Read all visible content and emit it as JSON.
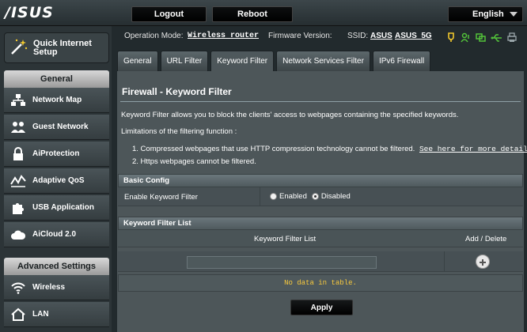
{
  "brand": {
    "logo_text": "/ISUS"
  },
  "topbar": {
    "logout_label": "Logout",
    "reboot_label": "Reboot",
    "language_value": "English"
  },
  "sidebar": {
    "quick_setup": "Quick Internet\nSetup",
    "general_header": "General",
    "general_items": [
      {
        "label": "Network Map",
        "icon": "network-map-icon"
      },
      {
        "label": "Guest Network",
        "icon": "guest-network-icon"
      },
      {
        "label": "AiProtection",
        "icon": "lock-icon"
      },
      {
        "label": "Adaptive QoS",
        "icon": "qos-icon"
      },
      {
        "label": "USB Application",
        "icon": "puzzle-icon"
      },
      {
        "label": "AiCloud 2.0",
        "icon": "cloud-icon"
      }
    ],
    "advanced_header": "Advanced Settings",
    "advanced_items": [
      {
        "label": "Wireless",
        "icon": "wifi-icon"
      },
      {
        "label": "LAN",
        "icon": "home-icon"
      }
    ]
  },
  "status": {
    "op_mode_label": "Operation Mode:",
    "op_mode_value": "Wireless router",
    "firmware_label": "Firmware Version:",
    "ssid_label": "SSID:",
    "ssid_1": "ASUS",
    "ssid_2": "ASUS_5G",
    "icon_names": [
      "alert-icon",
      "clients-icon",
      "network-icon",
      "usb-icon",
      "printer-icon"
    ],
    "accent_yellow": "#f2c82d",
    "accent_green": "#52c23a"
  },
  "tabs": [
    {
      "label": "General"
    },
    {
      "label": "URL Filter"
    },
    {
      "label": "Keyword Filter",
      "active": true
    },
    {
      "label": "Network Services Filter"
    },
    {
      "label": "IPv6 Firewall"
    }
  ],
  "content": {
    "title": "Firewall - Keyword Filter",
    "description": "Keyword Filter allows you to block the clients' access to webpages containing the specified keywords.",
    "limitations_label": "Limitations of the filtering function :",
    "limitation_1": "1.  Compressed webpages that use HTTP compression technology cannot be filtered.",
    "limitation_1_link": "See here for more details.",
    "limitation_2": "2.  Https webpages cannot be filtered.",
    "basic_config_header": "Basic Config",
    "enable_label": "Enable Keyword Filter",
    "option_enabled": "Enabled",
    "option_disabled": "Disabled",
    "selected_option": "Disabled",
    "list_header": "Keyword Filter List",
    "col_list": "Keyword Filter List",
    "col_action": "Add / Delete",
    "keyword_value": "",
    "no_data": "No data in table.",
    "apply_label": "Apply"
  }
}
